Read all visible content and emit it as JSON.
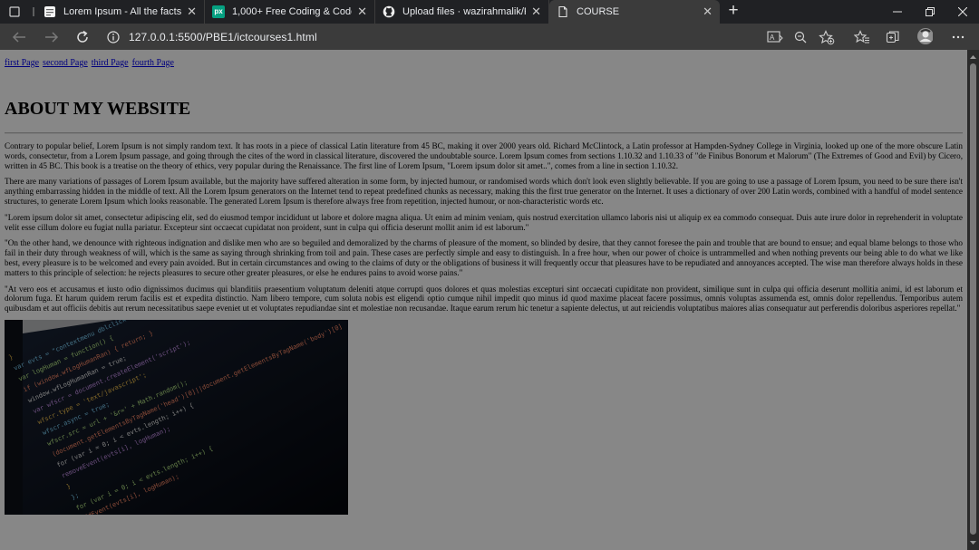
{
  "tabs": [
    {
      "title": "Lorem Ipsum - All the facts - Lip",
      "favicon": "lipsum-icon"
    },
    {
      "title": "1,000+ Free Coding & Code Ima",
      "favicon": "pexels-icon",
      "favicon_text": "px"
    },
    {
      "title": "Upload files · wazirahmalik/PBE1",
      "favicon": "github-icon"
    },
    {
      "title": "COURSE",
      "favicon": "page-icon",
      "active": true
    }
  ],
  "tab_close_glyph": "✕",
  "new_tab_glyph": "+",
  "address_bar": {
    "url": "127.0.0.1:5500/PBE1/ictcourses1.html"
  },
  "page": {
    "nav_links": [
      "first Page",
      "second Page",
      "third Page",
      "fourth Page"
    ],
    "heading": "ABOUT MY WEBSITE",
    "paragraphs": [
      "Contrary to popular belief, Lorem Ipsum is not simply random text. It has roots in a piece of classical Latin literature from 45 BC, making it over 2000 years old. Richard McClintock, a Latin professor at Hampden-Sydney College in Virginia, looked up one of the more obscure Latin words, consectetur, from a Lorem Ipsum passage, and going through the cites of the word in classical literature, discovered the undoubtable source. Lorem Ipsum comes from sections 1.10.32 and 1.10.33 of \"de Finibus Bonorum et Malorum\" (The Extremes of Good and Evil) by Cicero, written in 45 BC. This book is a treatise on the theory of ethics, very popular during the Renaissance. The first line of Lorem Ipsum, \"Lorem ipsum dolor sit amet..\", comes from a line in section 1.10.32.",
      "There are many variations of passages of Lorem Ipsum available, but the majority have suffered alteration in some form, by injected humour, or randomised words which don't look even slightly believable. If you are going to use a passage of Lorem Ipsum, you need to be sure there isn't anything embarrassing hidden in the middle of text. All the Lorem Ipsum generators on the Internet tend to repeat predefined chunks as necessary, making this the first true generator on the Internet. It uses a dictionary of over 200 Latin words, combined with a handful of model sentence structures, to generate Lorem Ipsum which looks reasonable. The generated Lorem Ipsum is therefore always free from repetition, injected humour, or non-characteristic words etc.",
      "\"Lorem ipsum dolor sit amet, consectetur adipiscing elit, sed do eiusmod tempor incididunt ut labore et dolore magna aliqua. Ut enim ad minim veniam, quis nostrud exercitation ullamco laboris nisi ut aliquip ex ea commodo consequat. Duis aute irure dolor in reprehenderit in voluptate velit esse cillum dolore eu fugiat nulla pariatur. Excepteur sint occaecat cupidatat non proident, sunt in culpa qui officia deserunt mollit anim id est laborum.\"",
      "\"On the other hand, we denounce with righteous indignation and dislike men who are so beguiled and demoralized by the charms of pleasure of the moment, so blinded by desire, that they cannot foresee the pain and trouble that are bound to ensue; and equal blame belongs to those who fail in their duty through weakness of will, which is the same as saying through shrinking from toil and pain. These cases are perfectly simple and easy to distinguish. In a free hour, when our power of choice is untrammelled and when nothing prevents our being able to do what we like best, every pleasure is to be welcomed and every pain avoided. But in certain circumstances and owing to the claims of duty or the obligations of business it will frequently occur that pleasures have to be repudiated and annoyances accepted. The wise man therefore always holds in these matters to this principle of selection: he rejects pleasures to secure other greater pleasures, or else he endures pains to avoid worse pains.\"",
      "\"At vero eos et accusamus et iusto odio dignissimos ducimus qui blanditiis praesentium voluptatum deleniti atque corrupti quos dolores et quas molestias excepturi sint occaecati cupiditate non provident, similique sunt in culpa qui officia deserunt mollitia animi, id est laborum et dolorum fuga. Et harum quidem rerum facilis est et expedita distinctio. Nam libero tempore, cum soluta nobis est eligendi optio cumque nihil impedit quo minus id quod maxime placeat facere possimus, omnis voluptas assumenda est, omnis dolor repellendus. Temporibus autem quibusdam et aut officiis debitis aut rerum necessitatibus saepe eveniet ut et voluptates repudiandae sint et molestiae non recusandae. Itaque earum rerum hic tenetur a sapiente delectus, ut aut reiciendis voluptatibus maiores alias consequatur aut perferendis doloribus asperiores repellat.\""
    ],
    "image_code_lines": [
      "}",
      "var evts = \"contextmenu dblclick drag dragend dragenter",
      "var logHuman = function() {",
      "  if (window.wfLogHumanRan) { return; }",
      "  window.wfLogHumanRan = true;",
      "  var wfscr = document.createElement('script');",
      "  wfscr.type = 'text/javascript';",
      "  wfscr.async = true;",
      "  wfscr.src = url + '&r=' + Math.random();",
      "  (document.getElementsByTagName('head')[0]||document.getElementsByTagName('body')[0]",
      "  for (var i = 0; i < evts.length; i++) {",
      "    removeEvent(evts[i], logHuman);",
      "  }",
      "};",
      "for (var i = 0; i < evts.length; i++) {",
      "  addEvent(evts[i], logHuman);",
      "}"
    ]
  }
}
